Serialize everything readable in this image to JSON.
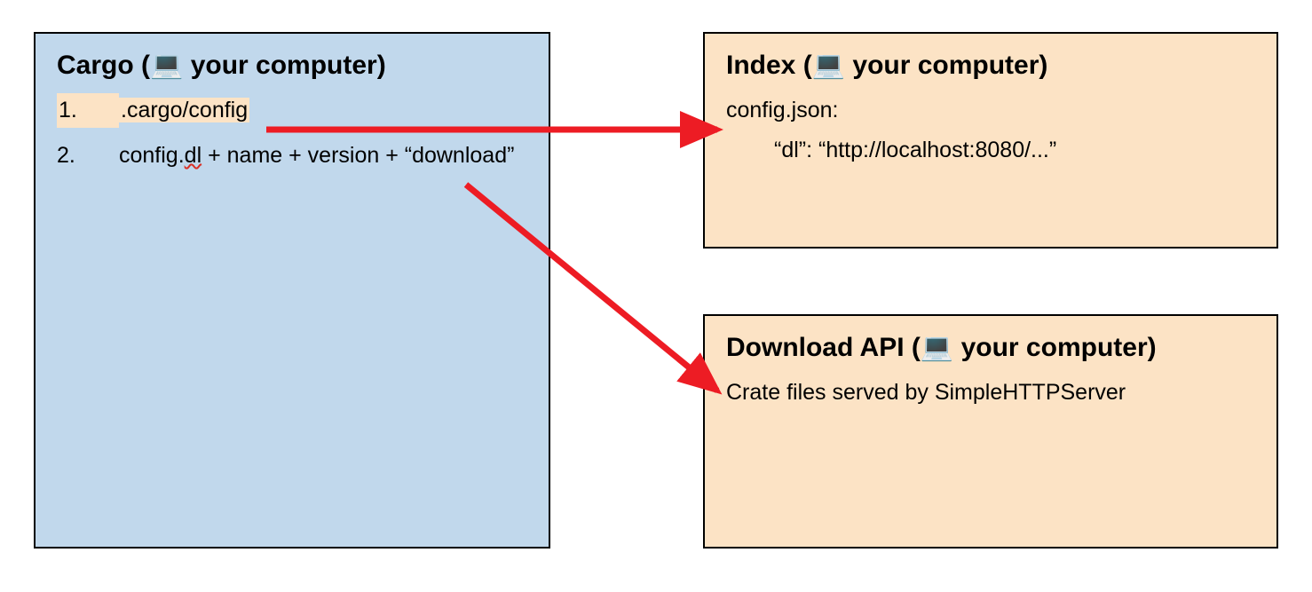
{
  "cargo": {
    "title_prefix": "Cargo (",
    "title_suffix": " your computer)",
    "items": [
      {
        "num": "1.",
        "text": ".cargo/config",
        "highlight": true
      },
      {
        "num": "2.",
        "text_prefix": "config.",
        "squiggle": "dl",
        "text_suffix": " + name + version + “download”"
      }
    ]
  },
  "index": {
    "title_prefix": "Index (",
    "title_suffix": " your computer)",
    "line1": "config.json:",
    "line2": "“dl”: “http://localhost:8080/...”"
  },
  "download": {
    "title_prefix": "Download API (",
    "title_suffix": " your computer)",
    "body": "Crate files served by SimpleHTTPServer"
  },
  "icons": {
    "laptop": "💻"
  }
}
